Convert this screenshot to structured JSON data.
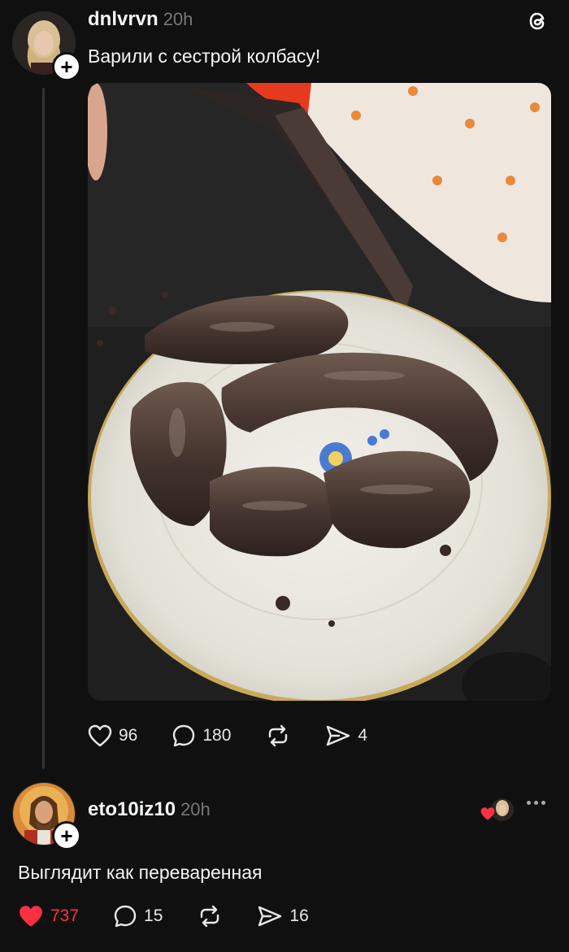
{
  "post": {
    "username": "dnlvrvn",
    "time": "20h",
    "text": "Варили с сестрой колбасу!",
    "likes": "96",
    "comments": "180",
    "shares": "4"
  },
  "reply": {
    "username": "eto10iz10",
    "time": "20h",
    "text": "Выглядит как переваренная",
    "likes": "737",
    "comments": "15",
    "shares": "16"
  },
  "colors": {
    "background": "#101010",
    "like_red": "#ff3040",
    "muted": "#777777"
  }
}
